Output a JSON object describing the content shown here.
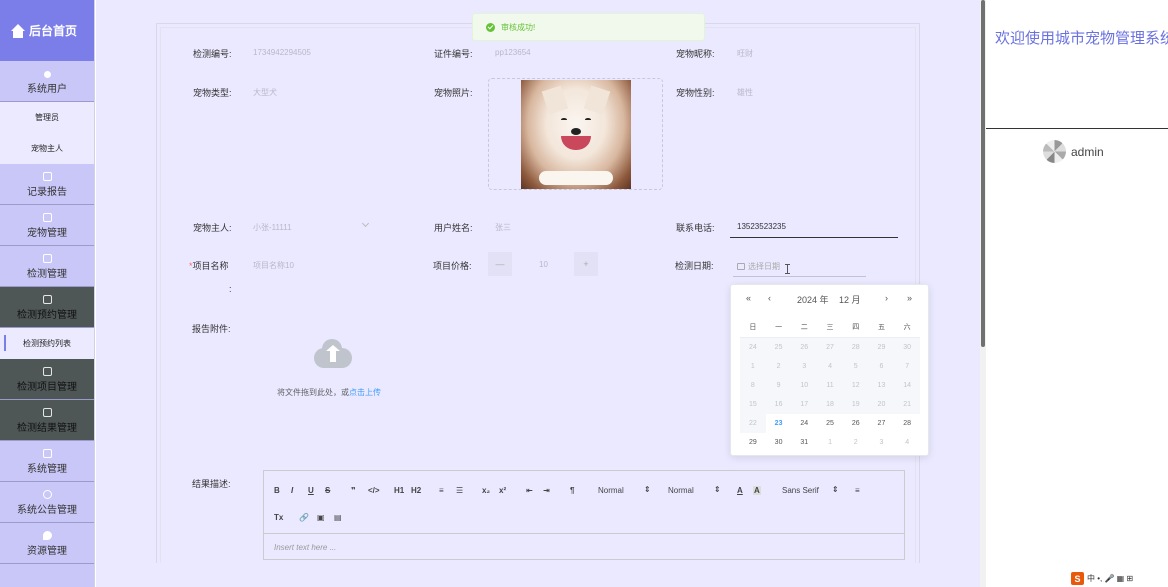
{
  "app": {
    "home": "后台首页",
    "welcome": "欢迎使用城市宠物管理系统",
    "username": "admin"
  },
  "sidebar": {
    "items": [
      {
        "label": "系统用户",
        "icon": "user-icon"
      },
      {
        "label": "管理员"
      },
      {
        "label": "宠物主人"
      },
      {
        "label": "记录报告",
        "icon": "doc-icon"
      },
      {
        "label": "宠物管理",
        "icon": "doc-icon"
      },
      {
        "label": "检测管理",
        "icon": "doc-icon"
      },
      {
        "label": "检测预约管理",
        "icon": "doc-icon"
      },
      {
        "label": "检测预约列表"
      },
      {
        "label": "检测项目管理",
        "icon": "doc-icon"
      },
      {
        "label": "检测结果管理",
        "icon": "doc-icon"
      },
      {
        "label": "系统管理",
        "icon": "image-icon"
      },
      {
        "label": "系统公告管理",
        "icon": "info-icon"
      },
      {
        "label": "资源管理",
        "icon": "pin-icon"
      }
    ]
  },
  "toast": {
    "text": "审核成功!"
  },
  "form": {
    "detect_no": {
      "label": "检测编号:",
      "value": "1734942294505"
    },
    "cert_no": {
      "label": "证件编号:",
      "value": "pp123654"
    },
    "pet_nick": {
      "label": "宠物昵称:",
      "value": "旺财"
    },
    "pet_type": {
      "label": "宠物类型:",
      "value": "大型犬"
    },
    "pet_photo": {
      "label": "宠物照片:"
    },
    "pet_sex": {
      "label": "宠物性别:",
      "value": "雄性"
    },
    "owner": {
      "label": "宠物主人:",
      "value": "小张-11111"
    },
    "user_name": {
      "label": "用户姓名:",
      "value": "张三"
    },
    "phone": {
      "label": "联系电话:",
      "value": "13523523235"
    },
    "item_name": {
      "label": "项目名称",
      "required": "*",
      "colon": ":",
      "placeholder": "项目名称10"
    },
    "item_price": {
      "label": "项目价格:",
      "value": "10",
      "minus": "—",
      "plus": "+"
    },
    "detect_date": {
      "label": "检测日期:",
      "placeholder": "选择日期"
    },
    "attachment": {
      "label": "报告附件:",
      "upload_text": "将文件拖到此处，或",
      "upload_link": "点击上传"
    },
    "result": {
      "label": "结果描述:",
      "placeholder": "Insert text here ..."
    }
  },
  "calendar": {
    "nav": {
      "prev_year": "«",
      "prev_month": "‹",
      "next_month": "›",
      "next_year": "»"
    },
    "year": "2024 年",
    "month": "12 月",
    "weekdays": [
      "日",
      "一",
      "二",
      "三",
      "四",
      "五",
      "六"
    ],
    "rows": [
      [
        "24",
        "25",
        "26",
        "27",
        "28",
        "29",
        "30"
      ],
      [
        "1",
        "2",
        "3",
        "4",
        "5",
        "6",
        "7"
      ],
      [
        "8",
        "9",
        "10",
        "11",
        "12",
        "13",
        "14"
      ],
      [
        "15",
        "16",
        "17",
        "18",
        "19",
        "20",
        "21"
      ],
      [
        "22",
        "23",
        "24",
        "25",
        "26",
        "27",
        "28"
      ],
      [
        "29",
        "30",
        "31",
        "1",
        "2",
        "3",
        "4"
      ]
    ]
  },
  "editor": {
    "toolbar": [
      "B",
      "I",
      "U",
      "S",
      "❞",
      "</>",
      "H1",
      "H2",
      "≡",
      "☰",
      "x₂",
      "x²",
      "⇤",
      "⇥",
      "¶",
      "Normal",
      "Normal",
      "A",
      "A",
      "Sans Serif",
      "≡",
      "Tx",
      "🔗",
      "▣",
      "▤"
    ]
  },
  "ime": {
    "s": "S",
    "text": "中 •, 🎤 ▦ ⊞"
  }
}
